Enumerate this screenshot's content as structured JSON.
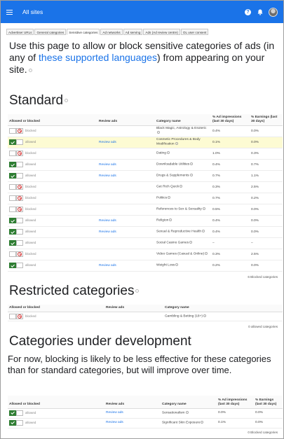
{
  "header": {
    "title": "All sites",
    "icons": [
      "menu-icon",
      "help-icon",
      "notifications-icon",
      "account-avatar"
    ]
  },
  "tabs": [
    {
      "label": "Advertiser URLs",
      "active": false
    },
    {
      "label": "General categories",
      "active": false
    },
    {
      "label": "Sensitive categories",
      "active": true
    },
    {
      "label": "Ad networks",
      "active": false
    },
    {
      "label": "Ad serving",
      "active": false
    },
    {
      "label": "Ads (Ad review centre)",
      "active": false
    },
    {
      "label": "OL user consent",
      "active": false
    }
  ],
  "intro": {
    "before": "Use this page to allow or block sensitive categories of ads (in any of ",
    "link": "these supported languages",
    "after": ") from appearing on your site."
  },
  "standard": {
    "heading": "Standard",
    "columns": [
      "Allowed or blocked",
      "Review ads",
      "Category name",
      "% Ad impressions (last 30 days)",
      "% Earnings (last 30 days)"
    ],
    "rows": [
      {
        "state": "blocked",
        "status": "blocked",
        "review": "",
        "name": "Black Magic, Astrology & Esoteric",
        "impressions": "0.4%",
        "earnings": "0.0%"
      },
      {
        "state": "allowed",
        "status": "allowed",
        "review": "Review ads",
        "name": "Cosmetic Procedures & Body Modification",
        "impressions": "0.1%",
        "earnings": "0.0%",
        "highlight": true
      },
      {
        "state": "blocked",
        "status": "blocked",
        "review": "",
        "name": "Dating",
        "impressions": "1.0%",
        "earnings": "0.3%"
      },
      {
        "state": "allowed",
        "status": "allowed",
        "review": "Review ads",
        "name": "Downloadable Utilities",
        "impressions": "0.4%",
        "earnings": "0.7%"
      },
      {
        "state": "allowed",
        "status": "allowed",
        "review": "Review ads",
        "name": "Drugs & Supplements",
        "impressions": "0.7%",
        "earnings": "1.1%"
      },
      {
        "state": "blocked",
        "status": "blocked",
        "review": "",
        "name": "Get Rich Quick",
        "impressions": "0.3%",
        "earnings": "2.5%"
      },
      {
        "state": "blocked",
        "status": "blocked",
        "review": "",
        "name": "Politics",
        "impressions": "0.7%",
        "earnings": "0.2%"
      },
      {
        "state": "blocked",
        "status": "blocked",
        "review": "",
        "name": "References to Sex & Sexuality",
        "impressions": "0.5%",
        "earnings": "0.0%"
      },
      {
        "state": "allowed",
        "status": "allowed",
        "review": "Review ads",
        "name": "Religion",
        "impressions": "0.4%",
        "earnings": "0.0%"
      },
      {
        "state": "allowed",
        "status": "allowed",
        "review": "Review ads",
        "name": "Sexual & Reproductive Health",
        "impressions": "0.4%",
        "earnings": "0.0%"
      },
      {
        "state": "allowed",
        "status": "allowed",
        "review": "",
        "name": "Social Casino Games",
        "impressions": "–",
        "earnings": "–"
      },
      {
        "state": "blocked",
        "status": "blocked",
        "review": "",
        "name": "Video Games (Casual & Online)",
        "impressions": "0.3%",
        "earnings": "2.5%"
      },
      {
        "state": "allowed",
        "status": "allowed",
        "review": "Review ads",
        "name": "Weight Loss",
        "impressions": "0.2%",
        "earnings": "0.0%"
      }
    ],
    "footnote": "6 Blocked categories"
  },
  "restricted": {
    "heading": "Restricted categories",
    "columns": [
      "Allowed or blocked",
      "Review ads",
      "Category name"
    ],
    "rows": [
      {
        "state": "blocked",
        "status": "blocked",
        "review": "",
        "name": "Gambling & Betting (18+)"
      }
    ],
    "footnote": "0 allowed categories"
  },
  "development": {
    "heading": "Categories under development",
    "text": "For now, blocking is likely to be less effective for these categories than for standard categories, but will improve over time.",
    "columns": [
      "Allowed or blocked",
      "Review ads",
      "Category name",
      "% Ad impressions (last 30 days)",
      "% Earnings (last 30 days)"
    ],
    "rows": [
      {
        "state": "allowed",
        "status": "allowed",
        "review": "Review ads",
        "name": "Sensationalism",
        "impressions": "0.0%",
        "earnings": "0.0%"
      },
      {
        "state": "allowed",
        "status": "allowed",
        "review": "Review ads",
        "name": "Significant Skin Exposure",
        "impressions": "0.1%",
        "earnings": "0.0%"
      }
    ],
    "footnote": "0 Blocked categories"
  }
}
